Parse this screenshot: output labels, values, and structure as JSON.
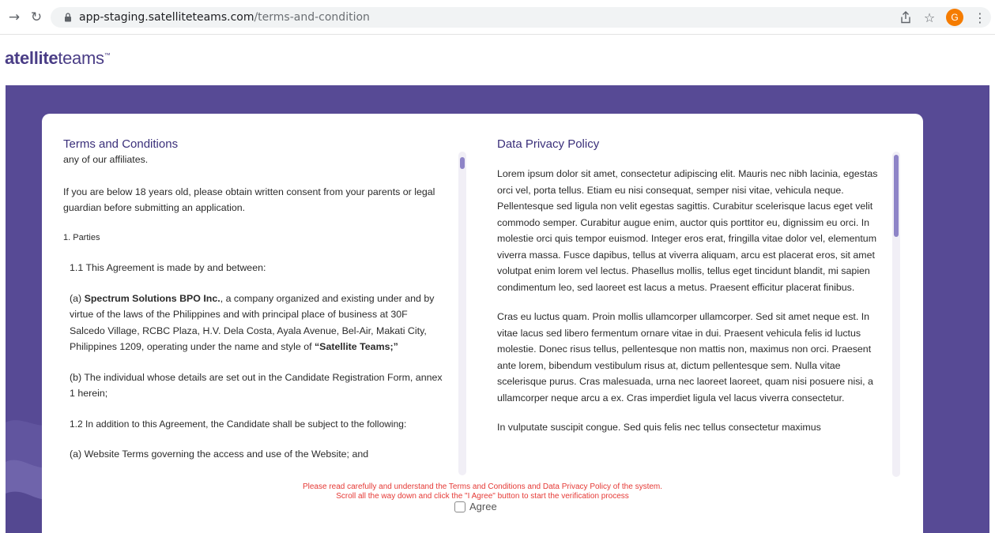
{
  "browser": {
    "url_domain": "app-staging.satelliteteams.com",
    "url_path": "/terms-and-condition",
    "back_icon": "arrow-right-icon",
    "reload_icon": "reload-icon",
    "profile_initial": "G"
  },
  "app": {
    "logo_bold": "atellite",
    "logo_light": "teams",
    "logo_tm": "™"
  },
  "terms": {
    "title": "Terms and Conditions",
    "paragraphs": [
      "any of our affiliates.",
      "If you are below 18 years old, please obtain written consent from your parents or legal guardian before submitting an application.",
      "1. Parties",
      "1.1 This Agreement is made by and between:",
      "(a) |Spectrum Solutions BPO Inc.|, a company organized and existing under and by virtue of the laws of the Philippines and with principal place of business at 30F Salcedo Village, RCBC Plaza, H.V. Dela Costa, Ayala Avenue, Bel-Air, Makati City, Philippines 1209, operating under the name and style of |“Satellite Teams;”|",
      "(b) The individual whose details are set out in the Candidate Registration Form, annex 1 herein;",
      "1.2 In addition to this Agreement, the Candidate shall be subject to the following:",
      "(a) Website Terms governing the access and use of the Website; and"
    ]
  },
  "privacy": {
    "title": "Data Privacy Policy",
    "paragraphs": [
      "Lorem ipsum dolor sit amet, consectetur adipiscing elit. Mauris nec nibh lacinia, egestas orci vel, porta tellus. Etiam eu nisi consequat, semper nisi vitae, vehicula neque. Pellentesque sed ligula non velit egestas sagittis. Curabitur scelerisque lacus eget velit commodo semper. Curabitur augue enim, auctor quis porttitor eu, dignissim eu orci. In molestie orci quis tempor euismod. Integer eros erat, fringilla vitae dolor vel, elementum viverra massa. Fusce dapibus, tellus at viverra aliquam, arcu est placerat eros, sit amet volutpat enim lorem vel lectus. Phasellus mollis, tellus eget tincidunt blandit, mi sapien condimentum leo, sed laoreet est lacus a metus. Praesent efficitur placerat finibus.",
      "Cras eu luctus quam. Proin mollis ullamcorper ullamcorper. Sed sit amet neque est. In vitae lacus sed libero fermentum ornare vitae in dui. Praesent vehicula felis id luctus molestie. Donec risus tellus, pellentesque non mattis non, maximus non orci. Praesent ante lorem, bibendum vestibulum risus at, dictum pellentesque sem. Nulla vitae scelerisque purus. Cras malesuada, urna nec laoreet laoreet, quam nisi posuere nisi, a ullamcorper neque arcu a ex. Cras imperdiet ligula vel lacus viverra consectetur.",
      "In vulputate suscipit congue. Sed quis felis nec tellus consectetur maximus"
    ]
  },
  "notice": {
    "line1": "Please read carefully and understand the Terms and Conditions and Data Privacy Policy of the system.",
    "line2": "Scroll all the way down and click the \"I Agree\" button to start the verification process"
  },
  "agree": {
    "label": "Agree",
    "checked": false
  },
  "colors": {
    "brand_purple": "#574a95",
    "title_purple": "#3a2f7a",
    "notice_red": "#e53935",
    "scroll_thumb": "#8e84c7"
  }
}
